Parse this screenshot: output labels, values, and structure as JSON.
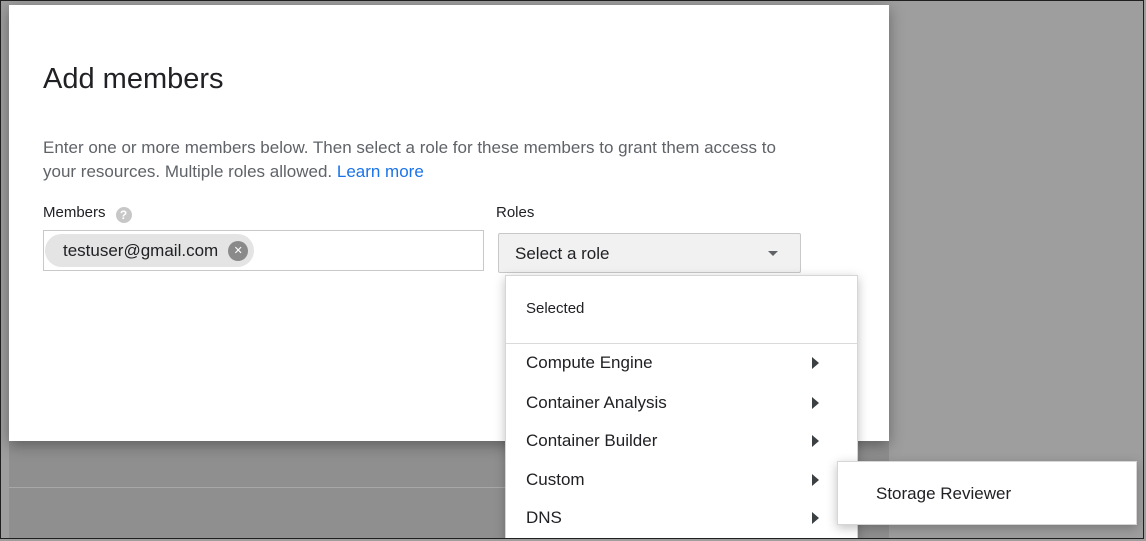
{
  "dialog": {
    "title": "Add members",
    "description": "Enter one or more members below. Then select a role for these members to grant them access to your resources. Multiple roles allowed.",
    "learn_more": "Learn more"
  },
  "members": {
    "label": "Members",
    "help_icon": "help-circle-icon",
    "chips": [
      {
        "email": "testuser@gmail.com",
        "remove_icon": "close-circle-icon"
      }
    ]
  },
  "roles": {
    "label": "Roles",
    "select_value": "Select a role",
    "arrow_icon": "caret-down-icon"
  },
  "role_menu": {
    "section_header": "Selected",
    "items": [
      {
        "label": "Compute Engine"
      },
      {
        "label": "Container Analysis"
      },
      {
        "label": "Container Builder"
      },
      {
        "label": "Custom"
      },
      {
        "label": "DNS"
      }
    ],
    "item_arrow_icon": "caret-right-icon"
  },
  "submenu": {
    "items": [
      {
        "label": "Storage Reviewer"
      }
    ]
  },
  "colors": {
    "overlay": "#9e9e9e",
    "link": "#1a73e8",
    "chip": "#e4e4e4"
  }
}
